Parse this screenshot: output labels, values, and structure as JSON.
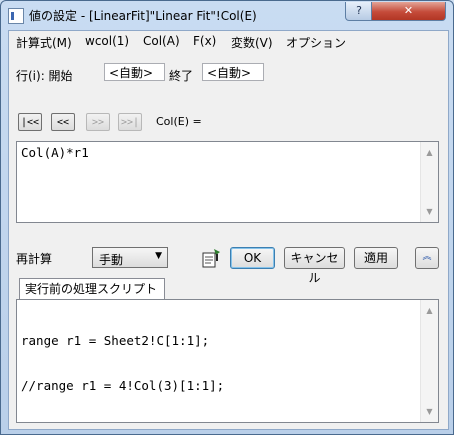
{
  "window": {
    "title": "値の設定 - [LinearFit]\"Linear Fit\"!Col(E)",
    "close_label": "✕"
  },
  "menu": [
    "計算式(M)",
    "wcol(1)",
    "Col(A)",
    "F(x)",
    "変数(V)",
    "オプション"
  ],
  "row_range": {
    "label": "行(i): 開始",
    "start_value": "<自動>",
    "end_label": "終了",
    "end_value": "<自動>"
  },
  "nav": {
    "first": "|<<",
    "prev": "<<",
    "next": ">>",
    "last": ">>|",
    "column_label": "Col(E) ="
  },
  "formula": {
    "text": "Col(A)*r1"
  },
  "recalc": {
    "label": "再計算",
    "mode": "手動"
  },
  "buttons": {
    "ok": "OK",
    "cancel": "キャンセル",
    "apply": "適用"
  },
  "script_tab": {
    "label": "実行前の処理スクリプト"
  },
  "script_lines": [
    "range r1 = Sheet2!C[1:1];",
    "//range r1 = 4!Col(3)[1:1];"
  ]
}
